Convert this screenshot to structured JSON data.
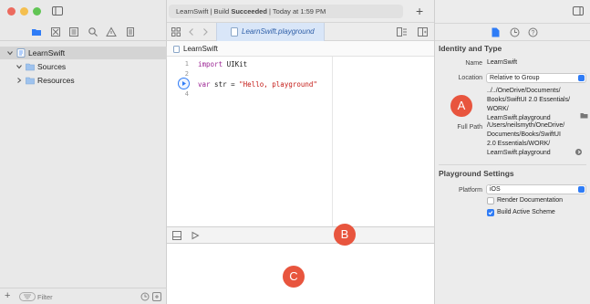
{
  "window": {
    "activity_prefix": "LearnSwift | Build ",
    "activity_status": "Succeeded",
    "activity_suffix": " | Today at 1:59 PM"
  },
  "navigator": {
    "tree": [
      {
        "label": "LearnSwift",
        "level": 0,
        "expanded": true
      },
      {
        "label": "Sources",
        "level": 1,
        "expanded": true
      },
      {
        "label": "Resources",
        "level": 1,
        "expanded": false
      }
    ],
    "filter_placeholder": "Filter"
  },
  "editor": {
    "tab_label": "LearnSwift.playground",
    "breadcrumb": "LearnSwift",
    "lines": [
      {
        "num": "1",
        "kw": "import",
        "rest": " UIKit"
      },
      {
        "num": "2",
        "kw": "",
        "rest": ""
      },
      {
        "num": "3",
        "kw": "var",
        "rest": " str = ",
        "str": "\"Hello, playground\""
      },
      {
        "num": "4",
        "kw": "",
        "rest": ""
      }
    ]
  },
  "inspector": {
    "identity_title": "Identity and Type",
    "name_label": "Name",
    "name_value": "LearnSwift",
    "location_label": "Location",
    "location_value": "Relative to Group",
    "relative_path": [
      "../../OneDrive/Documents/",
      "Books/SwiftUI 2.0 Essentials/",
      "WORK/",
      "LearnSwift.playground"
    ],
    "full_path_label": "Full Path",
    "full_path": [
      "/Users/neilsmyth/OneDrive/",
      "Documents/Books/SwiftUI",
      "2.0 Essentials/WORK/",
      "LearnSwift.playground"
    ],
    "playground_title": "Playground Settings",
    "platform_label": "Platform",
    "platform_value": "iOS",
    "render_docs_label": "Render Documentation",
    "render_docs_checked": false,
    "build_active_label": "Build Active Scheme",
    "build_active_checked": true
  },
  "callouts": {
    "a": "A",
    "b": "B",
    "c": "C"
  },
  "colors": {
    "accent": "#2f7cf6",
    "callout": "#e8553e",
    "keyword": "#9b2393",
    "string": "#c41a16"
  }
}
